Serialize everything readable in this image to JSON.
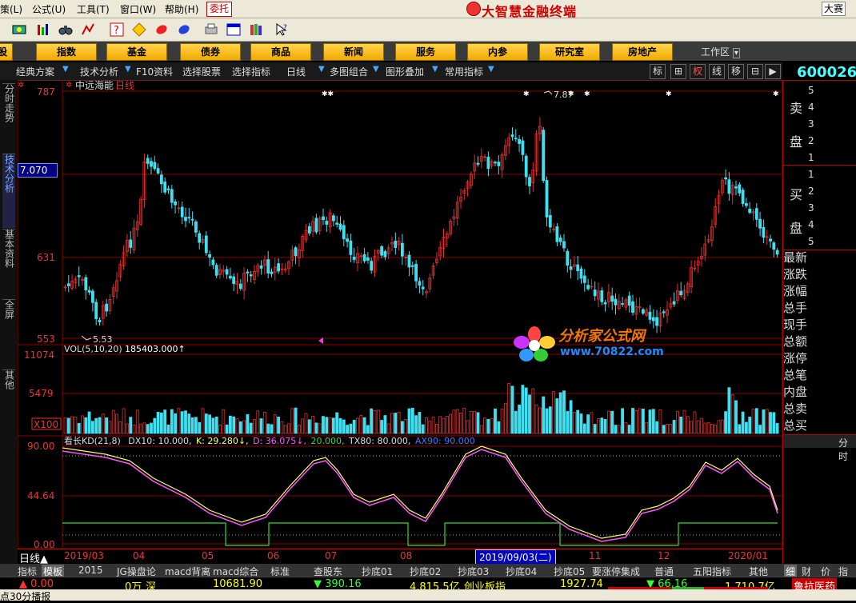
{
  "menu": {
    "items": [
      "策(L)",
      "公式(U)",
      "工具(T)",
      "窗口(W)",
      "帮助(H)"
    ],
    "weituo": "委托",
    "app_title": "大智慧金融终端",
    "dasai": "大赛"
  },
  "categories": [
    "股",
    "指数",
    "基金",
    "债券",
    "商品",
    "新闻",
    "服务",
    "内参",
    "研究室",
    "房地产"
  ],
  "workarea": "工作区",
  "funcbar": {
    "items": [
      "经典方案",
      "技术分析",
      "F10资料",
      "选择股票",
      "选择指标",
      "日线",
      "多图组合",
      "图形叠加",
      "常用指标"
    ],
    "right_buttons": [
      "标",
      "⊞",
      "权",
      "线",
      "移",
      "⊟",
      "▶"
    ]
  },
  "stock_code": "600026",
  "left_tabs": [
    "分时走势",
    "技术分析",
    "基本资料",
    "全屏",
    "其他"
  ],
  "chart": {
    "stock_name": "中远海能",
    "period": "日线",
    "price_badge": "7.070",
    "price_axis": [
      "787",
      "631",
      "553"
    ],
    "high_label": "7.87",
    "low_label": "5.53",
    "vol_label": "VOL(5,10,20)",
    "vol_value": "185403.000↑",
    "vol_axis": [
      "11074",
      "5479",
      "X100"
    ],
    "kd_label_name": "看长KD(21,8)",
    "kd_label_dx": "DX10: 10.000,",
    "kd_label_k": "K: 29.280↓,",
    "kd_label_d": "D: 36.075↓,",
    "kd_label_20": "20.000,",
    "kd_label_tx": "TX80: 80.000,",
    "kd_label_ax": "AX90: 90.000",
    "kd_axis": [
      "90.00",
      "44.64",
      "0.00"
    ]
  },
  "date_axis": {
    "labels": [
      "2019/03",
      "04",
      "05",
      "06",
      "07",
      "08",
      "10",
      "11",
      "12",
      "2020/01"
    ],
    "selected": "2019/09/03(二)",
    "day_line": "日线▲"
  },
  "right_panel": {
    "sell_label_1": "卖",
    "sell_label_2": "盘",
    "buy_label_1": "买",
    "buy_label_2": "盘",
    "sell_levels": [
      "5",
      "4",
      "3",
      "2",
      "1"
    ],
    "buy_levels": [
      "1",
      "2",
      "3",
      "4",
      "5"
    ],
    "fields": [
      "最新",
      "涨跌",
      "涨幅",
      "总手",
      "现手",
      "总额",
      "涨停",
      "总笔",
      "内盘",
      "总卖",
      "总买"
    ],
    "fenshi": "分时"
  },
  "bottom_tabs": [
    "指标",
    "模板",
    "2015",
    "JG操盘论",
    "macd背离",
    "macd综合",
    "标准",
    "查股东",
    "抄底01",
    "抄底02",
    "抄底03",
    "抄底04",
    "抄底05",
    "要涨停集成",
    "普通",
    "五阳指标",
    "其他",
    "细",
    "财",
    "价",
    "指"
  ],
  "status": {
    "s1": "▲ 0.00",
    "s2": "0万",
    "s3": "深",
    "s4": "10681.90",
    "s5": "▼ 390.16",
    "s6": "4,815.5亿",
    "s7": "创业板指",
    "s8": "1927.74",
    "s9": "▼ 66.16",
    "s10": "1,710.7亿",
    "s11": "鲁抗医药"
  },
  "marquee": "点30分播报",
  "watermark": {
    "title": "分析家公式网",
    "url": "www.70822.com"
  },
  "colors": {
    "up": "#e03030",
    "down": "#40e0f0",
    "k_line": "#ffff66",
    "d_line": "#ff55ff",
    "kd_green": "#33dd33",
    "grid": "#8b0000"
  }
}
